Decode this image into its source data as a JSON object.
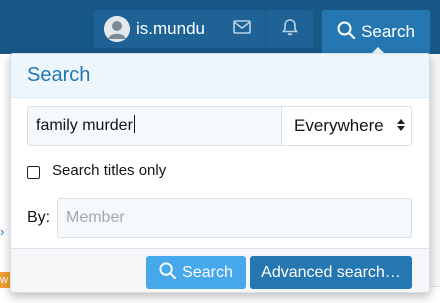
{
  "nav": {
    "username": "is.mundu",
    "search_label": "Search"
  },
  "search_menu": {
    "title": "Search",
    "query_value": "family murder",
    "scope_selected": "Everywhere",
    "titles_only_label": "Search titles only",
    "titles_only_checked": false,
    "by_label": "By:",
    "member_placeholder": "Member",
    "search_button": "Search",
    "advanced_button": "Advanced search…"
  },
  "background": {
    "edge_tag_text": "w"
  },
  "colors": {
    "nav_bar": "#185886",
    "accent": "#2577b1",
    "primary_button": "#47a7eb",
    "header_bg": "#edf6fd"
  },
  "icons": [
    "user-avatar-icon",
    "envelope-icon",
    "bell-icon",
    "search-icon"
  ]
}
